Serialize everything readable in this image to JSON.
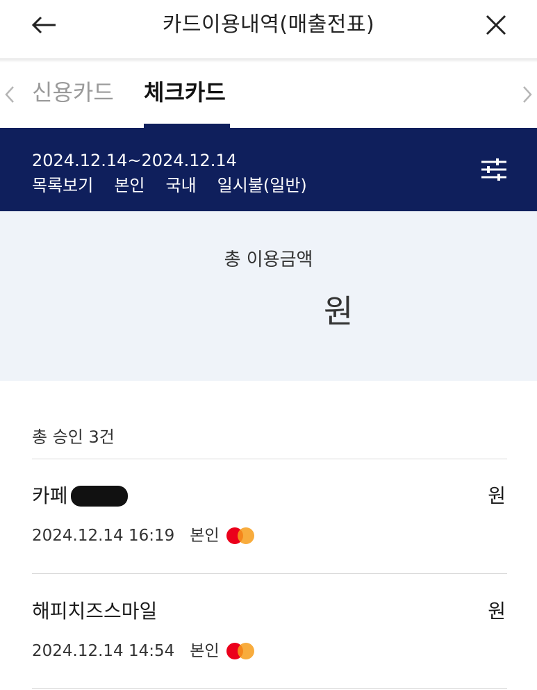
{
  "header": {
    "title": "카드이용내역(매출전표)",
    "back_icon": "arrow-left-icon",
    "close_icon": "close-icon"
  },
  "tabs": [
    {
      "label": "신용카드",
      "selected": false
    },
    {
      "label": "체크카드",
      "selected": true
    }
  ],
  "filter": {
    "period": "2024.12.14~2024.12.14",
    "options": [
      "목록보기",
      "본인",
      "국내",
      "일시불(일반)"
    ],
    "icon": "sliders-icon"
  },
  "summary": {
    "label": "총 이용금액",
    "unit": "원"
  },
  "list": {
    "count_text": "총 승인 3건",
    "items": [
      {
        "name": "카페",
        "redacted": true,
        "unit": "원",
        "datetime": "2024.12.14 16:19",
        "owner": "본인",
        "brand_icon": "mastercard-icon"
      },
      {
        "name": "해피치즈스마일",
        "redacted": false,
        "unit": "원",
        "datetime": "2024.12.14 14:54",
        "owner": "본인",
        "brand_icon": "mastercard-icon"
      }
    ]
  },
  "colors": {
    "primary_navy": "#0f1f5c",
    "summary_bg": "#eff3f9",
    "inactive_tab": "#9a9a9a"
  }
}
